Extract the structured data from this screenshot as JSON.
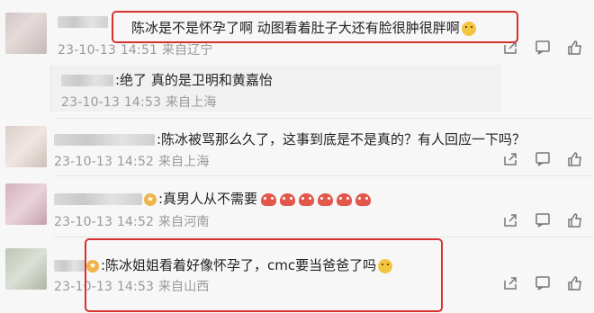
{
  "comments": [
    {
      "text": "陈冰是不是怀孕了啊 动图看着肚子大还有脸很肿很胖啊",
      "date": "23-10-13",
      "time": "14:51",
      "location": "来自辽宁",
      "emoji": "thinking-face"
    },
    {
      "reply_text": ":绝了 真的是卫明和黄嘉怡",
      "date": "23-10-13",
      "time": "14:53",
      "location": "来自上海"
    },
    {
      "text": ":陈冰被骂那么久了，这事到底是不是真的？有人回应一下吗？",
      "date": "23-10-13",
      "time": "14:52",
      "location": "来自上海"
    },
    {
      "text": ":真男人从不需要",
      "date": "23-10-13",
      "time": "14:52",
      "location": "来自河南",
      "emoji": "crab x6"
    },
    {
      "text": ":陈冰姐姐看着好像怀孕了，cmc要当爸爸了吗",
      "date": "23-10-13",
      "time": "14:53",
      "location": "来自山西",
      "emoji": "thinking-face"
    }
  ],
  "icons": [
    "share-icon",
    "comment-icon",
    "like-icon"
  ],
  "colors": {
    "highlight": "#d8322e",
    "meta": "#999999",
    "badge": "#f0b34a"
  }
}
